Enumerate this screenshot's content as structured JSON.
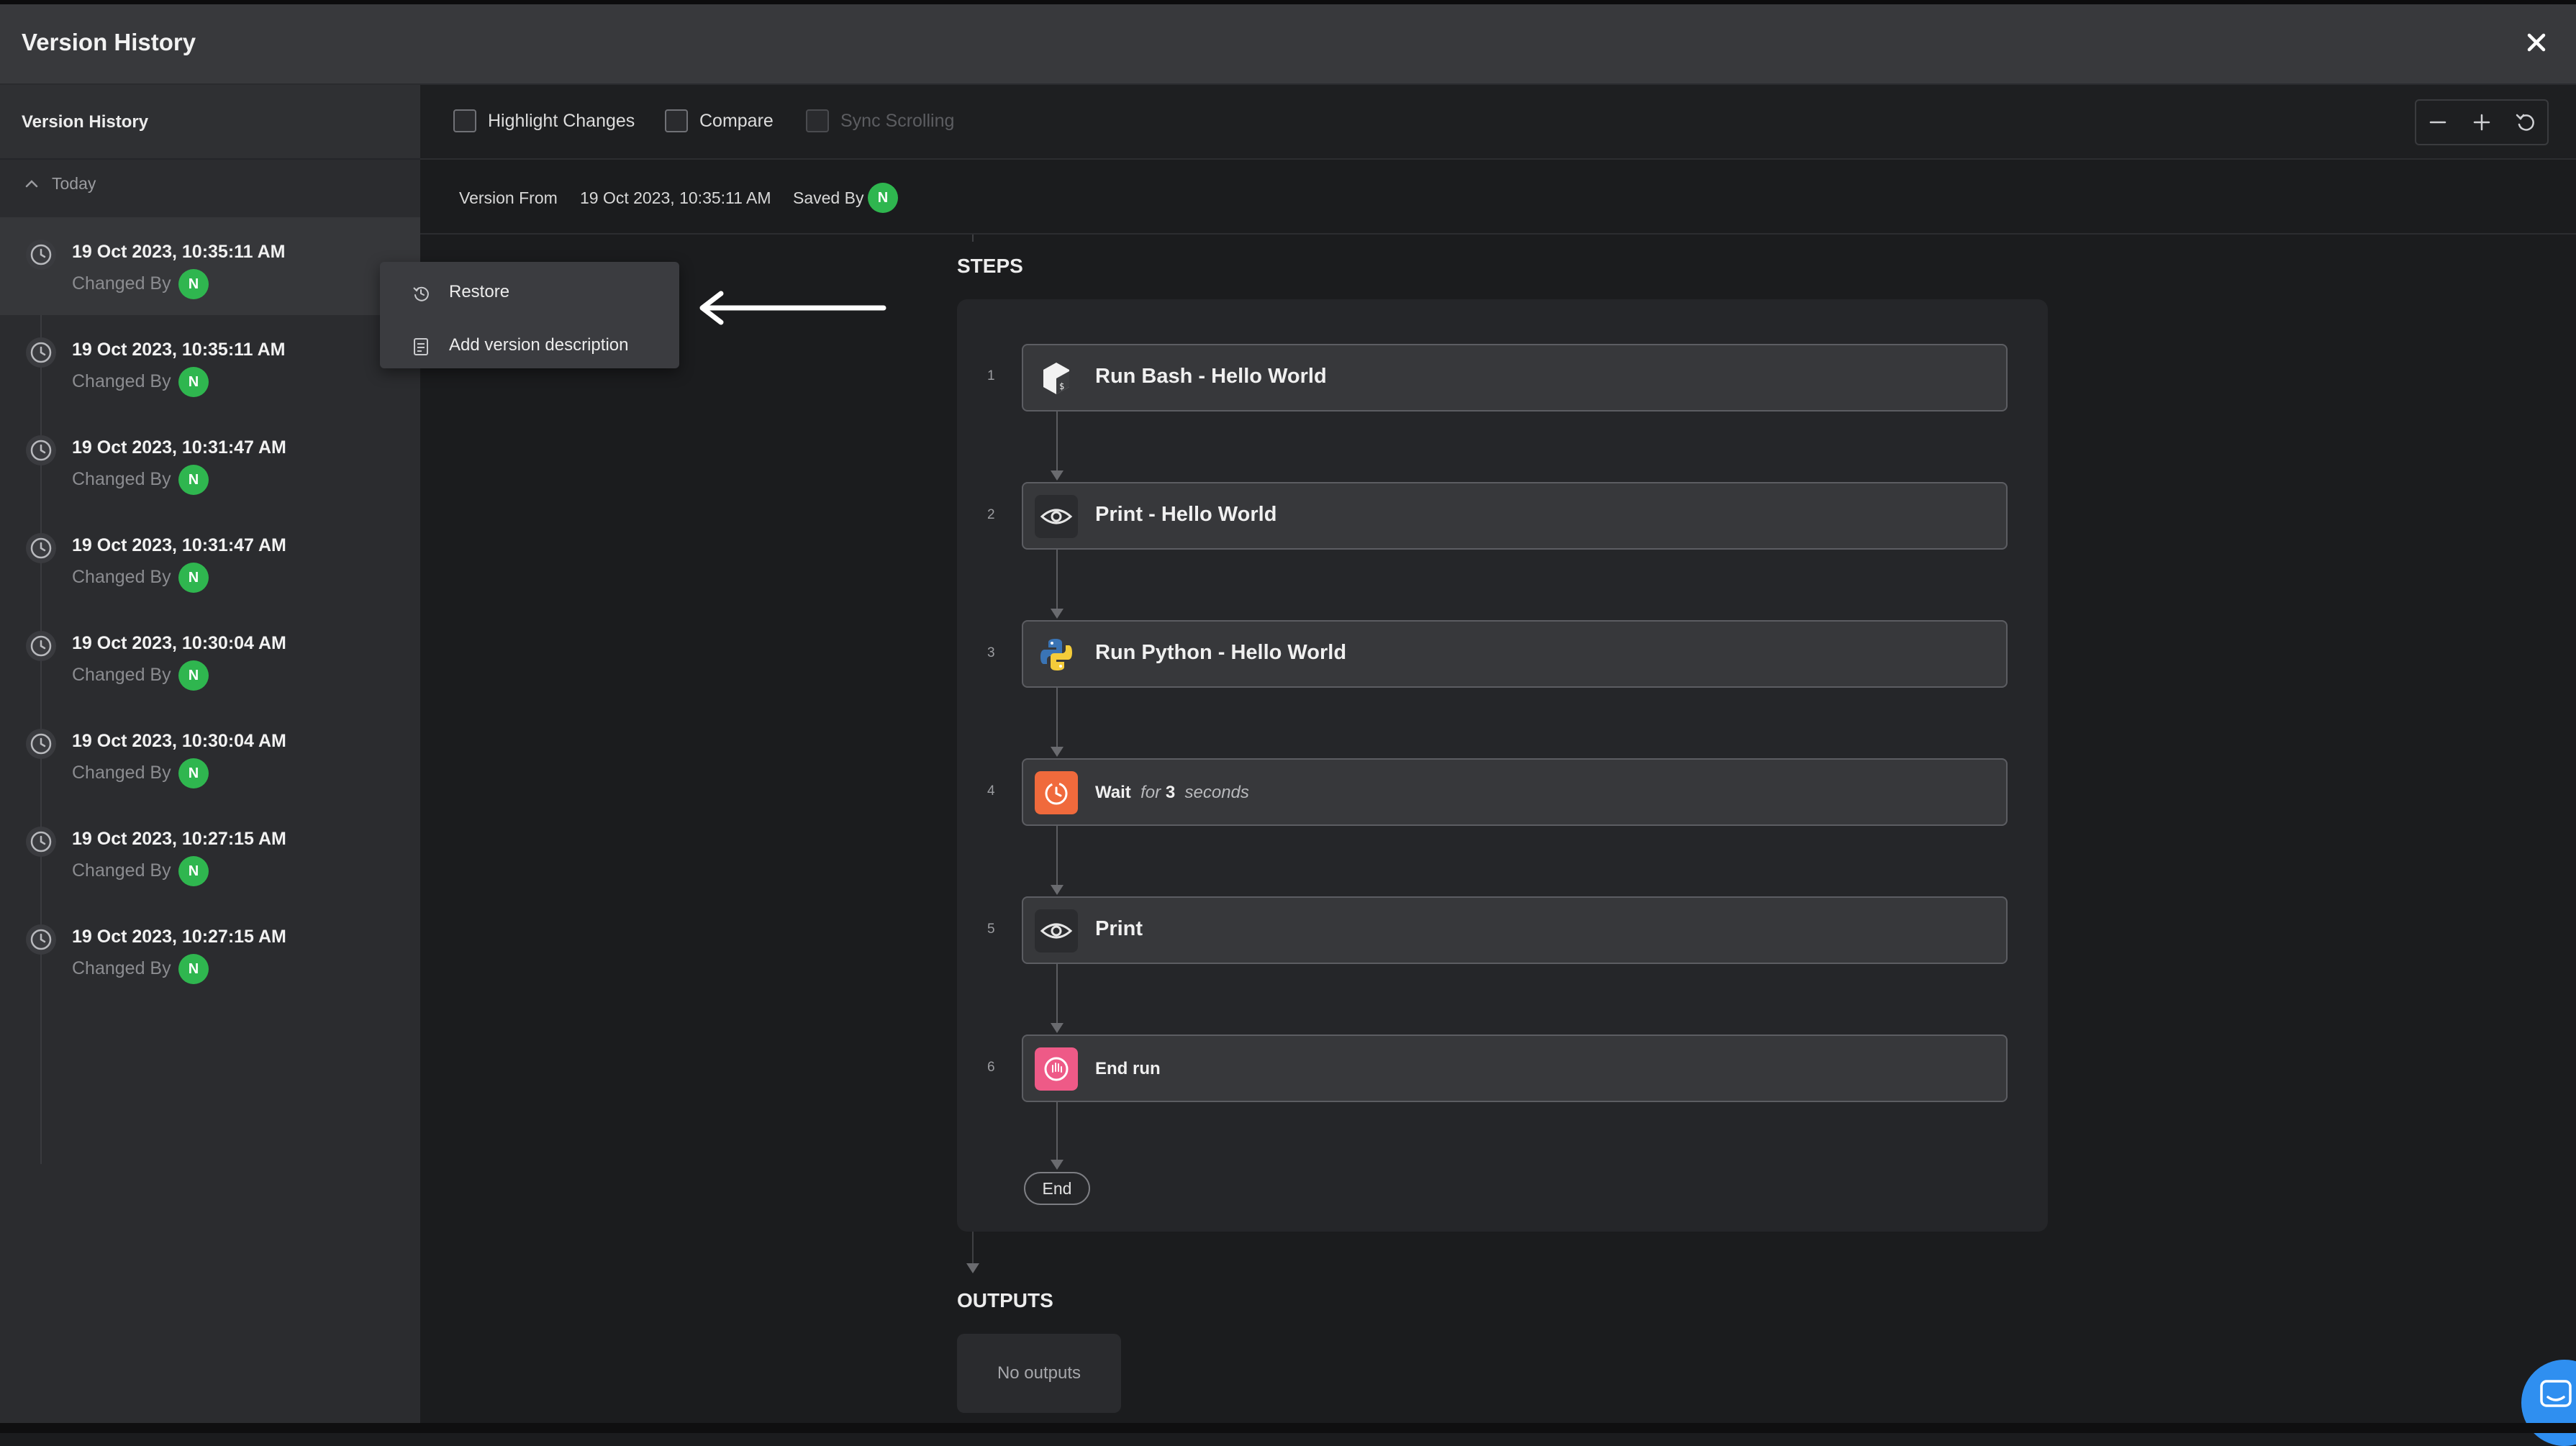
{
  "window": {
    "title": "Version History",
    "close_icon": "close-icon"
  },
  "sidebar": {
    "header": "Version History",
    "group": "Today",
    "changed_by_label": "Changed By",
    "items": [
      {
        "date": "19 Oct 2023, 10:35:11 AM",
        "avatar": "N",
        "selected": true
      },
      {
        "date": "19 Oct 2023, 10:35:11 AM",
        "avatar": "N"
      },
      {
        "date": "19 Oct 2023, 10:31:47 AM",
        "avatar": "N"
      },
      {
        "date": "19 Oct 2023, 10:31:47 AM",
        "avatar": "N"
      },
      {
        "date": "19 Oct 2023, 10:30:04 AM",
        "avatar": "N"
      },
      {
        "date": "19 Oct 2023, 10:30:04 AM",
        "avatar": "N"
      },
      {
        "date": "19 Oct 2023, 10:27:15 AM",
        "avatar": "N"
      },
      {
        "date": "19 Oct 2023, 10:27:15 AM",
        "avatar": "N"
      }
    ]
  },
  "toolbar": {
    "highlight_changes": "Highlight Changes",
    "compare": "Compare",
    "sync_scrolling": "Sync Scrolling",
    "zoom_icons": [
      "minus-icon",
      "plus-icon",
      "reset-zoom-icon"
    ]
  },
  "info": {
    "version_from_label": "Version From",
    "version_from_value": "19 Oct 2023, 10:35:11 AM",
    "saved_by_label": "Saved By",
    "saved_by_avatar": "N"
  },
  "context_menu": {
    "restore": "Restore",
    "add_description": "Add version description"
  },
  "workflow": {
    "steps_label": "STEPS",
    "outputs_label": "OUTPUTS",
    "no_outputs": "No outputs",
    "end_label": "End",
    "steps": [
      {
        "num": "1",
        "label": "Run Bash - Hello World",
        "icon": "bash-icon"
      },
      {
        "num": "2",
        "label": "Print - Hello World",
        "icon": "eye-icon"
      },
      {
        "num": "3",
        "label": "Run Python - Hello World",
        "icon": "python-icon"
      },
      {
        "num": "4",
        "label": "Wait",
        "for_text": "for",
        "amount": "3",
        "unit": "seconds",
        "icon": "timer-icon"
      },
      {
        "num": "5",
        "label": "Print",
        "icon": "eye-icon"
      },
      {
        "num": "6",
        "label": "End run",
        "icon": "stop-hand-icon"
      }
    ]
  },
  "colors": {
    "avatar": "#2fb64f",
    "wait_icon": "#f06a3c",
    "end_icon": "#ee5a87",
    "chat": "#2f8ff0"
  }
}
